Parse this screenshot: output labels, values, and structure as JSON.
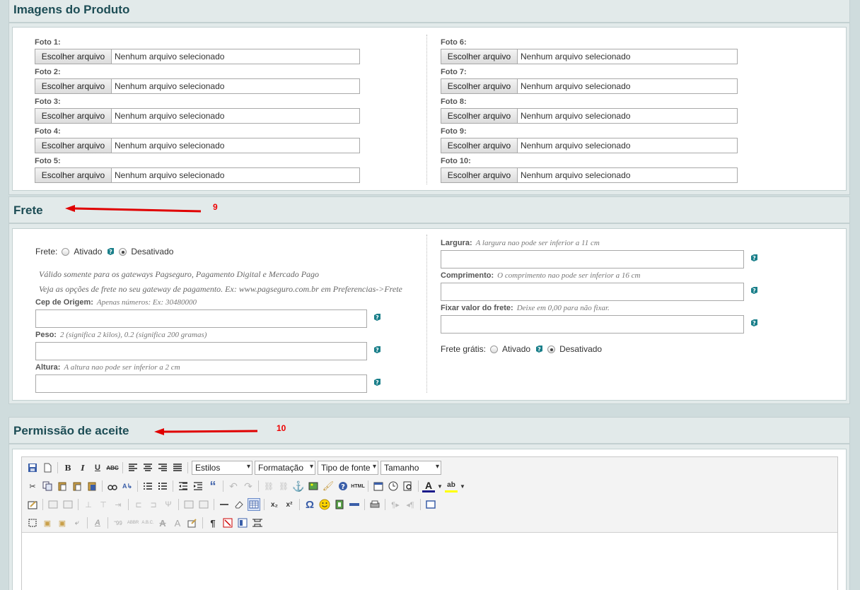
{
  "images_section": {
    "title": "Imagens do Produto",
    "button_label": "Escolher arquivo",
    "no_file_text": "Nenhum arquivo selecionado",
    "left_fields": [
      "Foto 1:",
      "Foto 2:",
      "Foto 3:",
      "Foto 4:",
      "Foto 5:"
    ],
    "right_fields": [
      "Foto 6:",
      "Foto 7:",
      "Foto 8:",
      "Foto 9:",
      "Foto 10:"
    ]
  },
  "frete_section": {
    "title": "Frete",
    "annotation": "9",
    "frete_label": "Frete:",
    "opt_on": "Ativado",
    "opt_off": "Desativado",
    "note1": "Válido somente para os gateways Pagseguro, Pagamento Digital e Mercado Pago",
    "note2": "Veja as opções de frete no seu gateway de pagamento. Ex: www.pagseguro.com.br em Preferencias->Frete",
    "cep_label": "Cep de Origem:",
    "cep_hint": "Apenas números: Ex: 30480000",
    "peso_label": "Peso:",
    "peso_hint": "2 (significa 2 kilos), 0.2 (significa 200 gramas)",
    "altura_label": "Altura:",
    "altura_hint": "A altura nao pode ser inferior a 2 cm",
    "largura_label": "Largura:",
    "largura_hint": "A largura nao pode ser inferior a 11 cm",
    "comprimento_label": "Comprimento:",
    "comprimento_hint": "O comprimento nao pode ser inferior a 16 cm",
    "fixar_label": "Fixar valor do frete:",
    "fixar_hint": "Deixe em 0,00 para não fixar.",
    "gratis_label": "Frete grátis:",
    "frete_selected": "Desativado",
    "gratis_selected": "Desativado"
  },
  "permissao_section": {
    "title": "Permissão de aceite",
    "annotation": "10",
    "toolbar": {
      "estilos": "Estilos",
      "formatacao": "Formatação",
      "tipo_fonte": "Tipo de fonte",
      "tamanho": "Tamanho",
      "bold": "B",
      "italic": "I",
      "underline": "U",
      "strike": "ABC",
      "quote": "“",
      "html": "HTML",
      "omega": "Ω",
      "pilcrow": "¶",
      "sub": "x₂",
      "sup": "x²"
    }
  },
  "colors": {
    "title": "#1d4d55",
    "arrow": "#e00000",
    "help_icon": "#1a7f8a"
  }
}
